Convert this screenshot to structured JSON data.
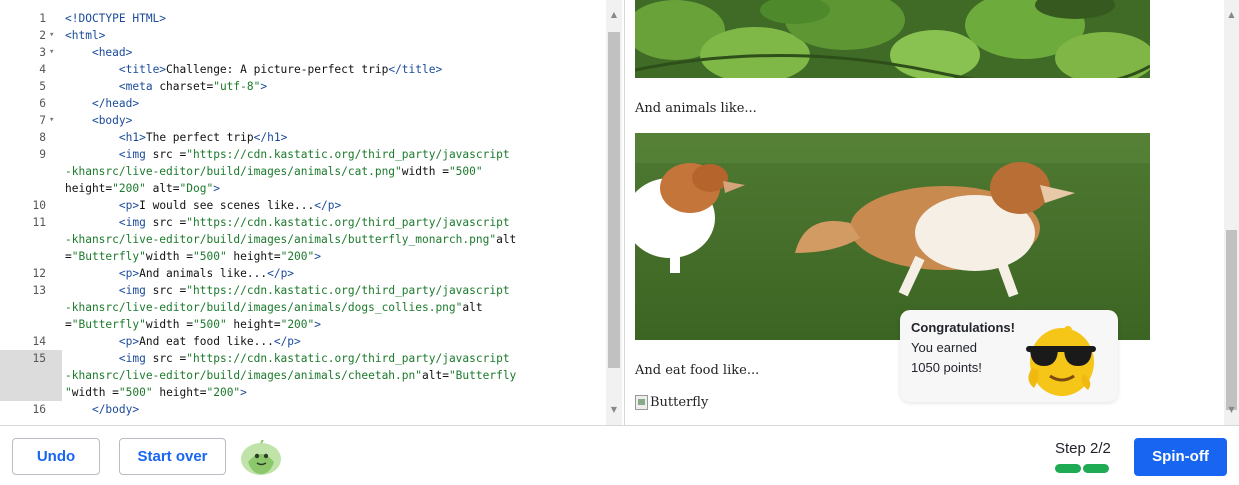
{
  "editor": {
    "line_numbers": [
      "1",
      "2",
      "3",
      "4",
      "5",
      "6",
      "7",
      "8",
      "9",
      "",
      "",
      "10",
      "11",
      "",
      "",
      "12",
      "13",
      "",
      "",
      "14",
      "15",
      "",
      "",
      "16"
    ],
    "lines": [
      {
        "segments": [
          [
            "t",
            "<!DOCTYPE HTML>"
          ]
        ]
      },
      {
        "segments": [
          [
            "t",
            "<html>"
          ]
        ]
      },
      {
        "segments": [
          [
            "p",
            "    "
          ],
          [
            "t",
            "<head>"
          ]
        ]
      },
      {
        "segments": [
          [
            "p",
            "        "
          ],
          [
            "t",
            "<title>"
          ],
          [
            "p",
            "Challenge: A picture-perfect trip"
          ],
          [
            "t",
            "</title>"
          ]
        ]
      },
      {
        "segments": [
          [
            "p",
            "        "
          ],
          [
            "t",
            "<meta "
          ],
          [
            "p",
            "charset="
          ],
          [
            "s",
            "\"utf-8\""
          ],
          [
            "t",
            ">"
          ]
        ]
      },
      {
        "segments": [
          [
            "p",
            "    "
          ],
          [
            "t",
            "</head>"
          ]
        ]
      },
      {
        "segments": [
          [
            "p",
            "    "
          ],
          [
            "t",
            "<body>"
          ]
        ]
      },
      {
        "segments": [
          [
            "p",
            "        "
          ],
          [
            "t",
            "<h1>"
          ],
          [
            "p",
            "The perfect trip"
          ],
          [
            "t",
            "</h1>"
          ]
        ]
      },
      {
        "segments": [
          [
            "p",
            "        "
          ],
          [
            "t",
            "<img "
          ],
          [
            "p",
            "src ="
          ],
          [
            "s",
            "\"https://cdn.kastatic.org/third_party/javascript"
          ]
        ]
      },
      {
        "segments": [
          [
            "s",
            "-khansrc/live-editor/build/images/animals/cat.png\""
          ],
          [
            "p",
            "width ="
          ],
          [
            "s",
            "\"500\""
          ]
        ]
      },
      {
        "segments": [
          [
            "p",
            "height="
          ],
          [
            "s",
            "\"200\""
          ],
          [
            "p",
            " alt="
          ],
          [
            "s",
            "\"Dog\""
          ],
          [
            "t",
            ">"
          ]
        ]
      },
      {
        "segments": [
          [
            "p",
            "        "
          ],
          [
            "t",
            "<p>"
          ],
          [
            "p",
            "I would see scenes like..."
          ],
          [
            "t",
            "</p>"
          ]
        ]
      },
      {
        "segments": [
          [
            "p",
            "        "
          ],
          [
            "t",
            "<img "
          ],
          [
            "p",
            "src ="
          ],
          [
            "s",
            "\"https://cdn.kastatic.org/third_party/javascript"
          ]
        ]
      },
      {
        "segments": [
          [
            "s",
            "-khansrc/live-editor/build/images/animals/butterfly_monarch.png\""
          ],
          [
            "p",
            "alt"
          ]
        ]
      },
      {
        "segments": [
          [
            "p",
            "="
          ],
          [
            "s",
            "\"Butterfly\""
          ],
          [
            "p",
            "width ="
          ],
          [
            "s",
            "\"500\""
          ],
          [
            "p",
            " height="
          ],
          [
            "s",
            "\"200\""
          ],
          [
            "t",
            ">"
          ]
        ]
      },
      {
        "segments": [
          [
            "p",
            "        "
          ],
          [
            "t",
            "<p>"
          ],
          [
            "p",
            "And animals like..."
          ],
          [
            "t",
            "</p>"
          ]
        ]
      },
      {
        "segments": [
          [
            "p",
            "        "
          ],
          [
            "t",
            "<img "
          ],
          [
            "p",
            "src ="
          ],
          [
            "s",
            "\"https://cdn.kastatic.org/third_party/javascript"
          ]
        ]
      },
      {
        "segments": [
          [
            "s",
            "-khansrc/live-editor/build/images/animals/dogs_collies.png\""
          ],
          [
            "p",
            "alt"
          ]
        ]
      },
      {
        "segments": [
          [
            "p",
            "="
          ],
          [
            "s",
            "\"Butterfly\""
          ],
          [
            "p",
            "width ="
          ],
          [
            "s",
            "\"500\""
          ],
          [
            "p",
            " height="
          ],
          [
            "s",
            "\"200\""
          ],
          [
            "t",
            ">"
          ]
        ]
      },
      {
        "segments": [
          [
            "p",
            "        "
          ],
          [
            "t",
            "<p>"
          ],
          [
            "p",
            "And eat food like..."
          ],
          [
            "t",
            "</p>"
          ]
        ]
      },
      {
        "segments": [
          [
            "p",
            "        "
          ],
          [
            "t",
            "<img "
          ],
          [
            "p",
            "src ="
          ],
          [
            "s",
            "\"https://cdn.kastatic.org/third_party/javascript"
          ]
        ]
      },
      {
        "segments": [
          [
            "s",
            "-khansrc/live-editor/build/images/animals/cheetah.pn\""
          ],
          [
            "p",
            "alt="
          ],
          [
            "s",
            "\"Butterfly"
          ]
        ]
      },
      {
        "segments": [
          [
            "s",
            "\""
          ],
          [
            "p",
            "width ="
          ],
          [
            "s",
            "\"500\""
          ],
          [
            "p",
            " height="
          ],
          [
            "s",
            "\"200\""
          ],
          [
            "t",
            ">"
          ]
        ]
      },
      {
        "segments": [
          [
            "p",
            "    "
          ],
          [
            "t",
            "</body>"
          ]
        ]
      }
    ]
  },
  "preview": {
    "text_animals": "And animals like...",
    "text_food": "And eat food like...",
    "broken_alt": "Butterfly"
  },
  "toast": {
    "title": "Congratulations!",
    "line1": "You earned",
    "line2": "1050 points!"
  },
  "toolbar": {
    "undo_label": "Undo",
    "start_over_label": "Start over",
    "step_label": "Step 2/2",
    "spinoff_label": "Spin-off"
  },
  "colors": {
    "accent": "#1865f2",
    "progress": "#1fab54"
  }
}
